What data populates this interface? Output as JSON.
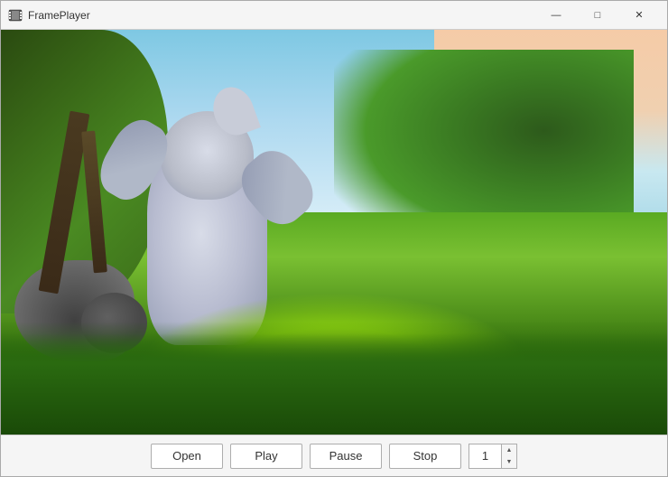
{
  "window": {
    "title": "FramePlayer",
    "controls": {
      "minimize": "—",
      "maximize": "□",
      "close": "✕"
    }
  },
  "toolbar": {
    "open_label": "Open",
    "play_label": "Play",
    "pause_label": "Pause",
    "stop_label": "Stop",
    "frame_value": "1",
    "frame_placeholder": "1"
  },
  "colors": {
    "title_bar_bg": "#f5f5f5",
    "toolbar_bg": "#f5f5f5",
    "video_bg": "#1a1a1a",
    "btn_border": "#adadad",
    "btn_bg": "#ffffff"
  }
}
